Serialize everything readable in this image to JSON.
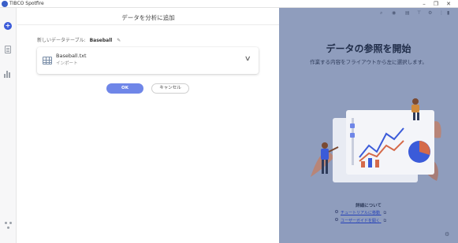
{
  "window": {
    "title": "TIBCO Spotfire",
    "minimize": "–",
    "maximize": "❐",
    "close": "✕"
  },
  "rail": {
    "add_symbol": "+"
  },
  "dialog": {
    "title": "データを分析に追加",
    "table_label": "新しいデータテーブル:",
    "table_name": "Baseball",
    "edit_symbol": "✎",
    "source": {
      "file_name": "Baseball.txt",
      "file_type": "インポート"
    },
    "ok_label": "OK",
    "cancel_label": "キャンセル"
  },
  "right_pane": {
    "heading": "データの参照を開始",
    "subtitle": "作業する内容をフライアウトから左に選択します。",
    "info_title": "詳細について",
    "links": [
      "チュートリアルに移動",
      "ユーザーガイドを開く"
    ],
    "link_icon": "⧉",
    "toolbar": [
      "⌕",
      "◉",
      "▤",
      "⊤",
      "⚙",
      "⋮",
      "▮"
    ],
    "bottom_icon": "⚙"
  },
  "icons": {
    "app": "spotfire-logo-icon",
    "add": "plus-icon",
    "data": "document-icon",
    "visualize": "bar-chart-icon",
    "collaborate": "network-icon",
    "table": "table-icon",
    "dropdown": "chevron-down-icon"
  },
  "colors": {
    "accent": "#3b5bd9",
    "ok_button": "#6f86e8",
    "right_pane_bg": "#8f9dbd",
    "link": "#2642b8"
  }
}
